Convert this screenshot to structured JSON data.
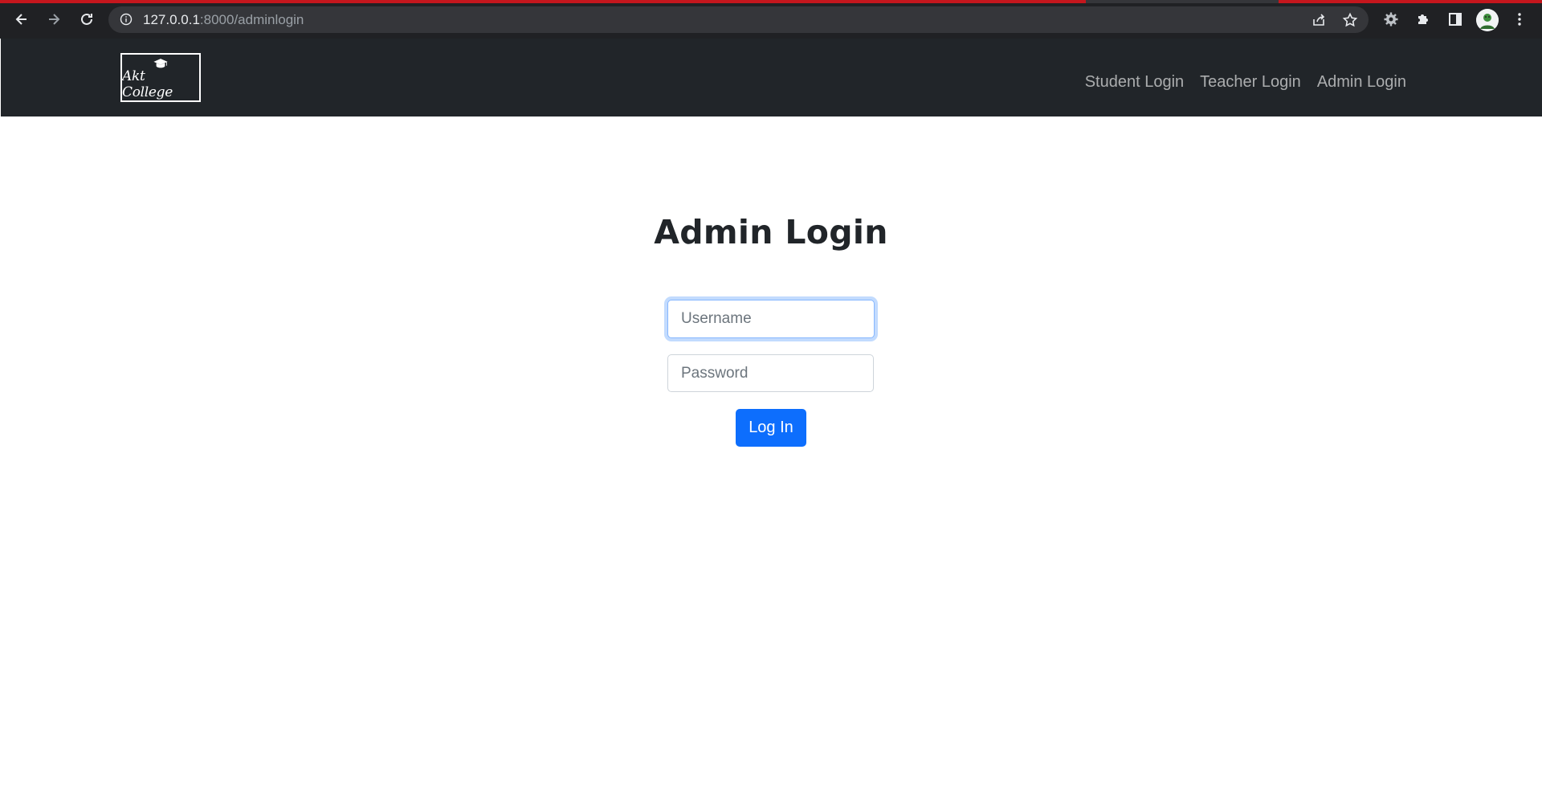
{
  "browser": {
    "url_host": "127.0.0.1",
    "url_rest": ":8000/adminlogin",
    "icons": [
      "back-arrow-icon",
      "forward-arrow-icon",
      "reload-icon",
      "info-icon",
      "share-icon",
      "star-icon",
      "extension-gear-icon",
      "puzzle-icon",
      "side-panel-icon",
      "avatar",
      "kebab-menu-icon"
    ]
  },
  "navbar": {
    "brand_text": "Akt College",
    "brand_icon": "graduation-cap-icon",
    "links": [
      "Student Login",
      "Teacher Login",
      "Admin Login"
    ]
  },
  "main": {
    "title": "Admin Login",
    "username_placeholder": "Username",
    "password_placeholder": "Password",
    "login_label": "Log In"
  },
  "colors": {
    "navbar_bg": "#212529",
    "primary": "#0d6efd",
    "focus_ring": "#86b7fe"
  }
}
